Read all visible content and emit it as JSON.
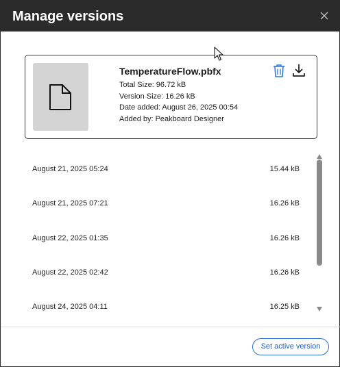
{
  "dialog": {
    "title": "Manage versions"
  },
  "file_card": {
    "file_name": "TemperatureFlow.pbfx",
    "total_size": "Total Size: 96.72 kB",
    "version_size": "Version Size: 16.26 kB",
    "date_added": "Date added: August 26, 2025 00:54",
    "added_by": "Added by: Peakboard Designer"
  },
  "versions": [
    {
      "date": "August 21, 2025 05:24",
      "size": "15.44 kB"
    },
    {
      "date": "August 21, 2025 07:21",
      "size": "16.26 kB"
    },
    {
      "date": "August 22, 2025 01:35",
      "size": "16.26 kB"
    },
    {
      "date": "August 22, 2025 02:42",
      "size": "16.26 kB"
    },
    {
      "date": "August 24, 2025 04:11",
      "size": "16.25 kB"
    }
  ],
  "footer": {
    "set_active_label": "Set active version"
  },
  "colors": {
    "titlebar": "#2b2b2b",
    "accent": "#1e5fc8",
    "trash_icon": "#2a7ad8",
    "thumbnail_bg": "#d4d4d4",
    "scroll_thumb": "#8a8a8a"
  },
  "icons": {
    "close": "close-icon",
    "file": "file-icon",
    "trash": "trash-icon",
    "download": "download-icon",
    "scroll_up": "chevron-up-icon",
    "scroll_down": "chevron-down-icon",
    "cursor": "mouse-pointer-icon"
  }
}
